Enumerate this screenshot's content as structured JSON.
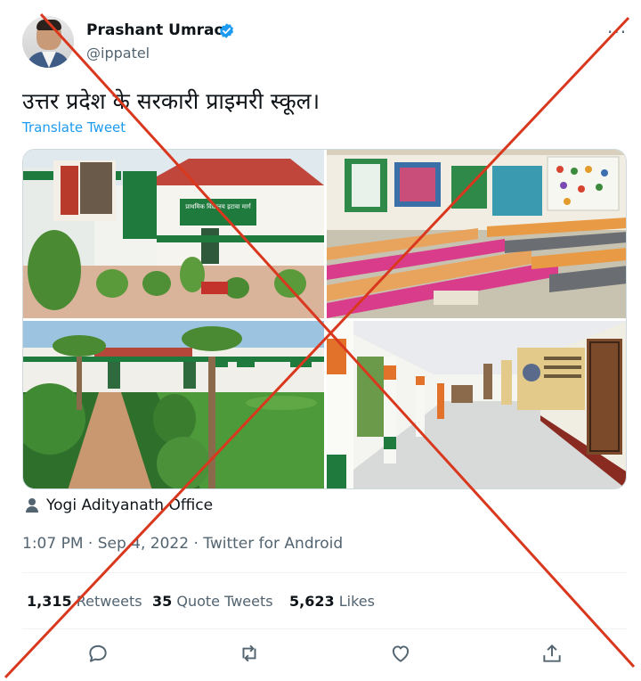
{
  "user": {
    "display_name": "Prashant Umrao",
    "handle": "@ippatel",
    "verified_color": "#1d9bf0"
  },
  "menu_icon": "more-options-icon",
  "tweet": {
    "text": "उत्तर प्रदेश के सरकारी प्राइमरी स्कूल।",
    "translate_label": "Translate Tweet",
    "source_label": "Yogi Adityanath Office",
    "timestamp": "1:07 PM · Sep 4, 2022 · Twitter for Android"
  },
  "media": {
    "photos": [
      {
        "name": "school-building-photo",
        "sign_text": "प्राथमिक विद्यालय इटावा मार्ग"
      },
      {
        "name": "classroom-benches-photo"
      },
      {
        "name": "school-garden-photo"
      },
      {
        "name": "school-corridor-photo"
      }
    ]
  },
  "stats": {
    "retweets_count": "1,315",
    "retweets_label": "Retweets",
    "quotes_count": "35",
    "quotes_label": "Quote Tweets",
    "likes_count": "5,623",
    "likes_label": "Likes"
  },
  "actions": [
    "reply-icon",
    "retweet-icon",
    "like-icon",
    "share-icon"
  ],
  "overlay": {
    "type": "red-cross",
    "color": "#d9381e"
  },
  "colors": {
    "link": "#1d9bf0",
    "text": "#0f1419",
    "secondary": "#536471"
  }
}
